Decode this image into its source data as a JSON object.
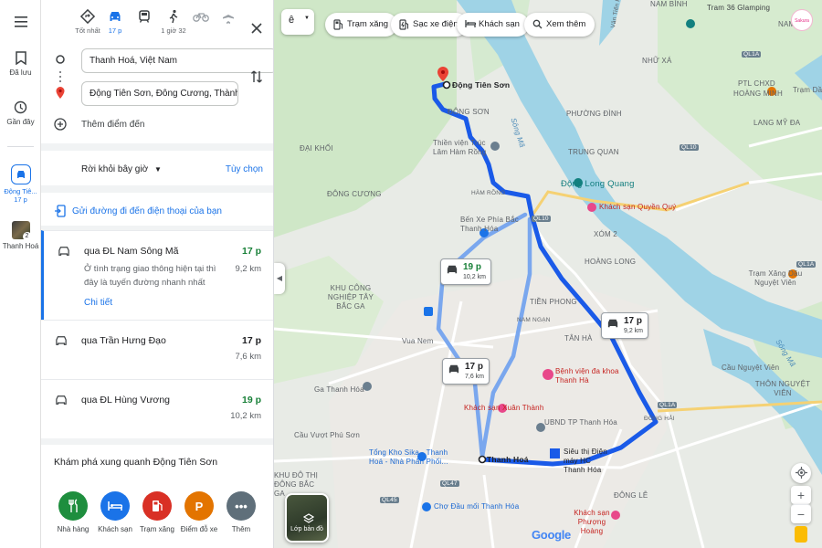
{
  "rail": {
    "saved": "Đã lưu",
    "recent": "Gần đây",
    "active_label_1": "Động Tiê...",
    "active_label_2": "17 p",
    "thumb_label": "Thanh Hoá",
    "thumb_badge": "2"
  },
  "modes": [
    {
      "label": "Tốt nhất"
    },
    {
      "label": "17 p"
    },
    {
      "label": ""
    },
    {
      "label": "1 giờ 32"
    },
    {
      "label": ""
    },
    {
      "label": ""
    }
  ],
  "waypoints": {
    "origin": "Thanh Hoá, Việt Nam",
    "destination": "Động Tiên Sơn, Đông Cương, Thành phố",
    "add": "Thêm điểm đến"
  },
  "leave": {
    "label": "Rời khỏi bây giờ",
    "options": "Tùy chọn"
  },
  "send": "Gửi đường đi đến điện thoại của bạn",
  "routes": [
    {
      "name": "qua ĐL Nam Sông Mã",
      "time": "17 p",
      "dist": "9,2 km",
      "desc": "Ở tình trạng giao thông hiện tại thì đây là tuyến đường nhanh nhất",
      "detail": "Chi tiết"
    },
    {
      "name": "qua Trần Hưng Đạo",
      "time": "17 p",
      "dist": "7,6 km"
    },
    {
      "name": "qua ĐL Hùng Vương",
      "time": "19 p",
      "dist": "10,2 km"
    }
  ],
  "explore": {
    "title": "Khám phá xung quanh Động Tiên Sơn",
    "categories": [
      {
        "label": "Nhà hàng",
        "color": "#1e8e3e"
      },
      {
        "label": "Khách sạn",
        "color": "#1a73e8"
      },
      {
        "label": "Trạm xăng",
        "color": "#d93025"
      },
      {
        "label": "Điểm đỗ xe",
        "color": "#e37400"
      },
      {
        "label": "Thêm",
        "color": "#5f6f7a"
      }
    ]
  },
  "chips": [
    {
      "label": "Trạm xăng"
    },
    {
      "label": "Sạc xe điện"
    },
    {
      "label": "Khách sạn"
    },
    {
      "label": "Xem thêm"
    }
  ],
  "map_menu": "ê",
  "avatar": "Sakura Pink",
  "map": {
    "dest": "Động Tiên Sơn",
    "origin": "Thanh Hoá",
    "boxes": [
      {
        "time": "19 p",
        "dist": "10,2 km"
      },
      {
        "time": "17 p",
        "dist": "7,6 km"
      },
      {
        "time": "17 p",
        "dist": "9,2 km"
      }
    ],
    "labels": {
      "tram36": "Tram 36 Glamping",
      "nam_binh": "NAM BÌNH",
      "nam_ly": "NAM LÝ",
      "nhu_xa": "NHỮ XÁ",
      "van_tien_phong": "Vân Tiến Phong",
      "dong_son": "ĐÔNG SƠN",
      "phuong_dinh": "PHƯỜNG ĐÌNH",
      "song_ma_1": "Sông Mã",
      "dai_khoi": "ĐẠI KHỐI",
      "thien_vien": "Thiền viện Trúc Lâm Hàm Rồng",
      "trung_quan": "TRUNG QUAN",
      "dong_cuong": "ĐÔNG CƯƠNG",
      "ham_rong": "HÀM RỒNG",
      "dong_long_quang": "Động Long Quang",
      "ks_quyen_quy": "Khách sạn Quyền Quý",
      "ben_xe": "Bến Xe Phía Bắc Thanh Hóa",
      "xom2": "XÓM 2",
      "hoang_long": "HOÀNG LONG",
      "hoang_minh": "HOÀNG MINH",
      "ptl_chxd": "PTL CHXD",
      "lang_my_da": "LANG MỸ ĐA",
      "tram_dau": "Trạm Dầu",
      "khu_cong_nghiep": "KHU CÔNG NGHIỆP TÂY BẮC GA",
      "tien_phong": "TIỀN PHONG",
      "nam_ngan": "NAM NGẠN",
      "tan_ha": "TÂN HÀ",
      "vua_nem": "Vua Nem",
      "benh_vien": "Bệnh viện đa khoa Thanh Hà",
      "cau_nguyet_vien": "Cầu Nguyệt Viên",
      "thon_nguyet_vien": "THÔN NGUYỆT VIÊN",
      "ga_thanh_hoa": "Ga Thanh Hóa",
      "ks_xuan_thanh": "Khách sạn Xuân Thành",
      "ubnd": "UBND TP Thanh Hóa",
      "dong_hai": "ĐÔNG HẢI",
      "cau_vuot": "Cầu Vượt Phú Sơn",
      "tong_kho": "Tổng Kho Sika - Thanh Hoá - Nhà Phân Phối...",
      "sieu_thi": "Siêu thị Điện máy HC Thanh Hóa",
      "khu_do_thi": "KHU ĐÔ THỊ ĐÔNG BẮC GA",
      "cho_dau_moi": "Chợ Đầu mối Thanh Hóa",
      "dong_le": "ĐÔNG LỄ",
      "ks_phuong_hoang": "Khách sạn Phượng Hoàng",
      "tram_xang_dau": "Trạm Xăng Dầu Nguyệt Viên",
      "song_ma_2": "Sông Mã",
      "ql1a_1": "QL1A",
      "ql1a_2": "QL1A",
      "ql1a_3": "QL1A",
      "ql10_1": "QL10",
      "ql10_2": "QL10",
      "ql47": "QL47",
      "ql45": "QL45"
    },
    "layers_label": "Lớp bản đồ",
    "google": "Google"
  }
}
